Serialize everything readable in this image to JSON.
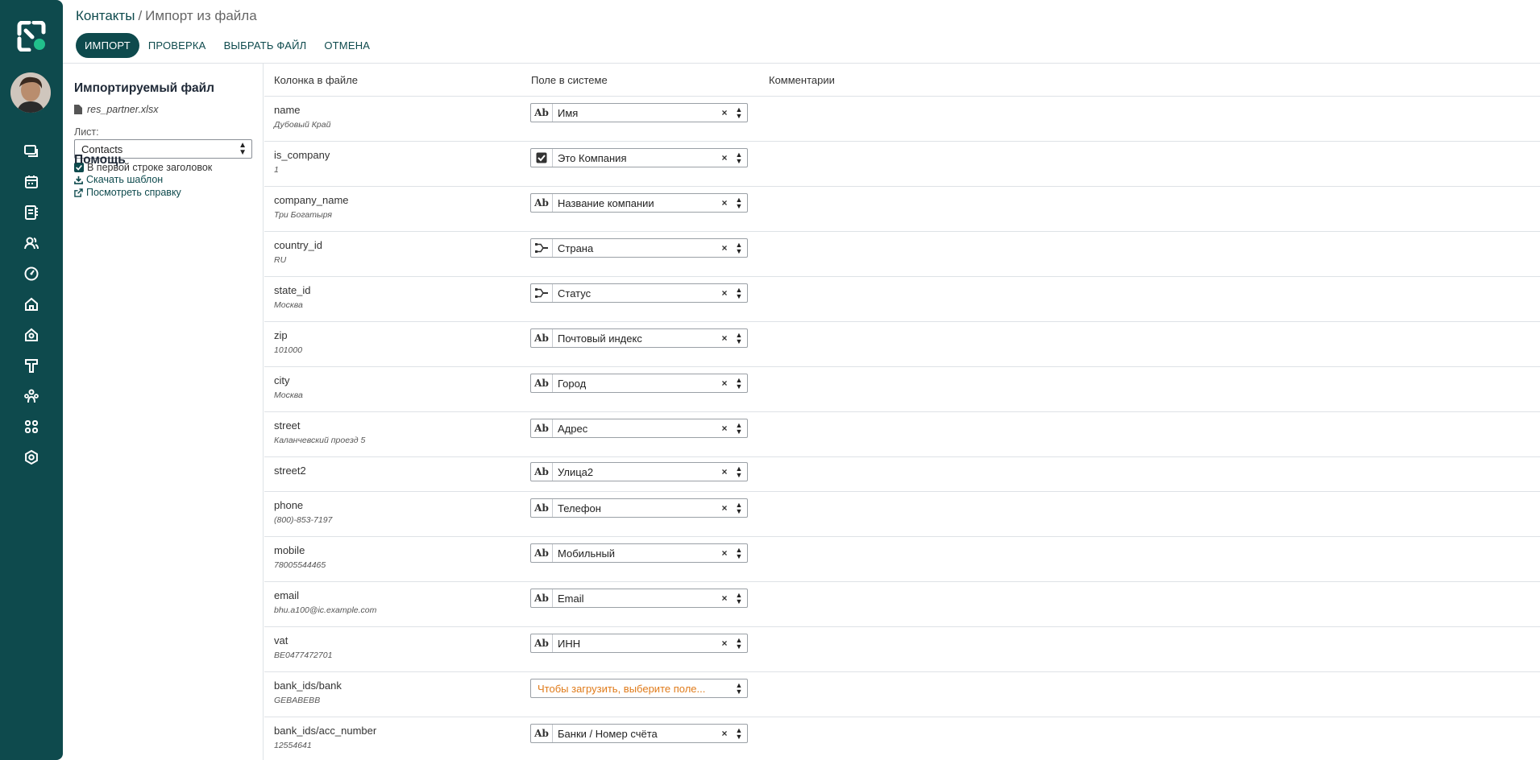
{
  "breadcrumb": {
    "parent": "Контакты",
    "separator": "/",
    "current": "Импорт из файла"
  },
  "toolbar": {
    "import_label": "ИМПОРТ",
    "test_label": "ПРОВЕРКА",
    "choose_file_label": "ВЫБРАТЬ ФАЙЛ",
    "cancel_label": "ОТМЕНА"
  },
  "sidebar": {
    "file_heading": "Импортируемый файл",
    "file_name": "res_partner.xlsx",
    "sheet_label": "Лист:",
    "sheet_value": "Contacts",
    "header_checkbox_label": "В первой строке заголовок",
    "help_heading": "Помощь",
    "download_template": "Скачать шаблон",
    "view_help": "Посмотреть справку"
  },
  "rail": {
    "icons": [
      "discuss-icon",
      "calendar-icon",
      "contacts-book-icon",
      "employees-icon",
      "dashboard-icon",
      "home-icon",
      "real-estate-icon",
      "tools-icon",
      "team-icon",
      "apps-icon",
      "settings-icon"
    ]
  },
  "table": {
    "headers": {
      "column": "Колонка в файле",
      "field": "Поле в системе",
      "comments": "Комментарии"
    },
    "rows": [
      {
        "column": "name",
        "sample": "Дубовый Край",
        "type": "text",
        "field": "Имя"
      },
      {
        "column": "is_company",
        "sample": "1",
        "type": "boolean",
        "field": "Это Компания"
      },
      {
        "column": "company_name",
        "sample": "Три Богатыря",
        "type": "text",
        "field": "Название компании"
      },
      {
        "column": "country_id",
        "sample": "RU",
        "type": "relation",
        "field": "Страна"
      },
      {
        "column": "state_id",
        "sample": "Москва",
        "type": "relation",
        "field": "Статус"
      },
      {
        "column": "zip",
        "sample": "101000",
        "type": "text",
        "field": "Почтовый индекс"
      },
      {
        "column": "city",
        "sample": "Москва",
        "type": "text",
        "field": "Город"
      },
      {
        "column": "street",
        "sample": "Каланчевский проезд 5",
        "type": "text",
        "field": "Адрес"
      },
      {
        "column": "street2",
        "sample": "",
        "type": "text",
        "field": "Улица2"
      },
      {
        "column": "phone",
        "sample": "(800)-853-7197",
        "type": "text",
        "field": "Телефон"
      },
      {
        "column": "mobile",
        "sample": "78005544465",
        "type": "text",
        "field": "Мобильный"
      },
      {
        "column": "email",
        "sample": "bhu.a100@ic.example.com",
        "type": "text",
        "field": "Email"
      },
      {
        "column": "vat",
        "sample": "BE0477472701",
        "type": "text",
        "field": "ИНН"
      },
      {
        "column": "bank_ids/bank",
        "sample": "GEBABEBB",
        "type": "placeholder",
        "field": "Чтобы загрузить, выберите поле..."
      },
      {
        "column": "bank_ids/acc_number",
        "sample": "12554641",
        "type": "text",
        "field": "Банки / Номер счёта"
      }
    ]
  },
  "colors": {
    "brand": "#0e4a4d",
    "warning_text": "#e07b1a"
  }
}
